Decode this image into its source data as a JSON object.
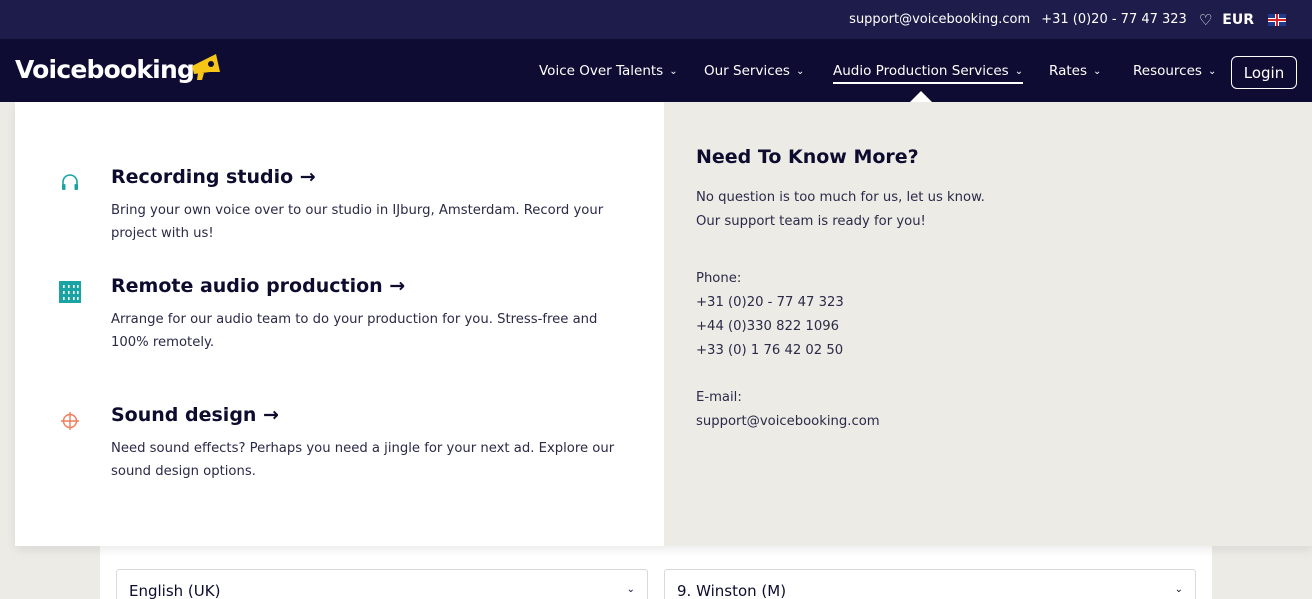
{
  "topbar": {
    "email": "support@voicebooking.com",
    "phone": "+31 (0)20 - 77 47 323",
    "favorites_icon": "heart-icon",
    "currency": "EUR",
    "language_flag": "uk-flag-icon"
  },
  "nav": {
    "logo": "Voicebooking",
    "logo_icon": "megaphone-icon",
    "items": [
      {
        "label": "Voice Over Talents"
      },
      {
        "label": "Our Services"
      },
      {
        "label": "Audio Production Services"
      },
      {
        "label": "Rates"
      },
      {
        "label": "Resources"
      }
    ],
    "active_item": "Audio Production Services",
    "login": "Login"
  },
  "dropdown": {
    "services": [
      {
        "title": "Recording studio →",
        "description": "Bring your own voice over to our studio in IJburg, Amsterdam. Record your project with us!",
        "icon": "headphones-icon"
      },
      {
        "title": "Remote audio production →",
        "description": "Arrange for our audio team to do your production for you. Stress-free and 100% remotely.",
        "icon": "mixer-icon"
      },
      {
        "title": "Sound design →",
        "description": "Need sound effects? Perhaps you need a jingle for your next ad. Explore our sound design options.",
        "icon": "crosshair-icon"
      }
    ],
    "help": {
      "title": "Need To Know More?",
      "line1": "No question is too much for us, let us know.",
      "line2": "Our support team is ready for you!",
      "phone_label": "Phone:",
      "phones": [
        "+31 (0)20 - 77 47 323",
        "+44 (0)330 822 1096",
        "+33 (0) 1 76 42 02 50"
      ],
      "email_label": "E-mail:",
      "email": "support@voicebooking.com"
    }
  },
  "form": {
    "language_value": "English (UK)",
    "voice_value": "9. Winston (M)"
  },
  "colors": {
    "topbar": "#1e1c4a",
    "navbar": "#0e0c33",
    "accent_yellow": "#f5c518",
    "teal": "#1aa3a3",
    "coral": "#f07b5a"
  }
}
